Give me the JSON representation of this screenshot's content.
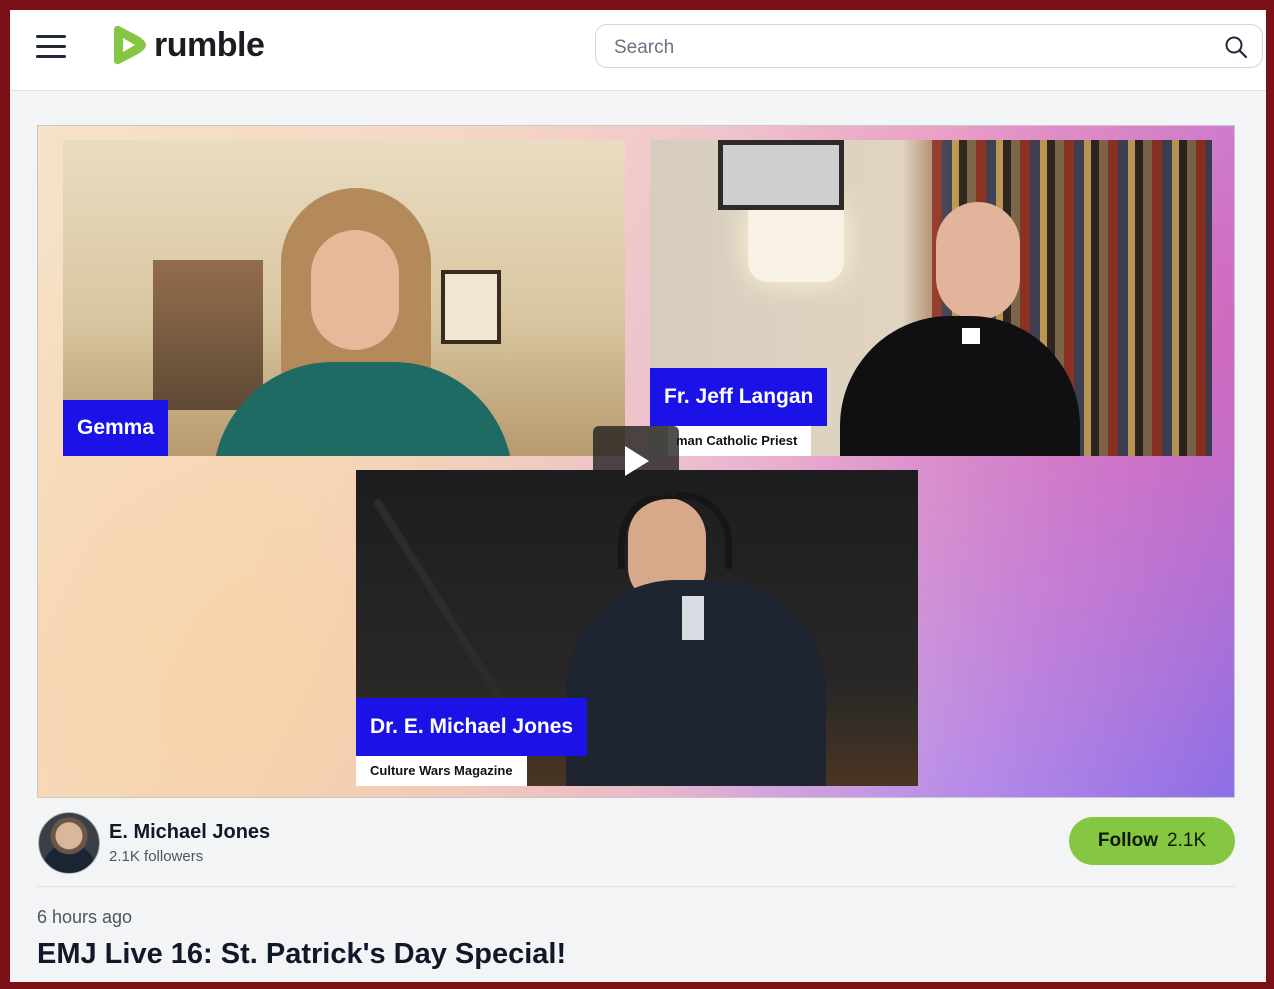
{
  "header": {
    "logo_text": "rumble",
    "search_placeholder": "Search",
    "brand_color": "#85c742"
  },
  "video": {
    "participants": [
      {
        "name": "Gemma",
        "subtitle": ""
      },
      {
        "name": "Fr. Jeff Langan",
        "subtitle": "man Catholic Priest"
      },
      {
        "name": "Dr. E. Michael Jones",
        "subtitle": "Culture Wars Magazine"
      }
    ],
    "play_icon": "play-icon"
  },
  "channel": {
    "name": "E. Michael Jones",
    "followers": "2.1K followers",
    "follow_label": "Follow",
    "follow_count": "2.1K"
  },
  "meta": {
    "time_ago": "6 hours ago",
    "title": "EMJ Live 16: St. Patrick's Day Special!"
  }
}
